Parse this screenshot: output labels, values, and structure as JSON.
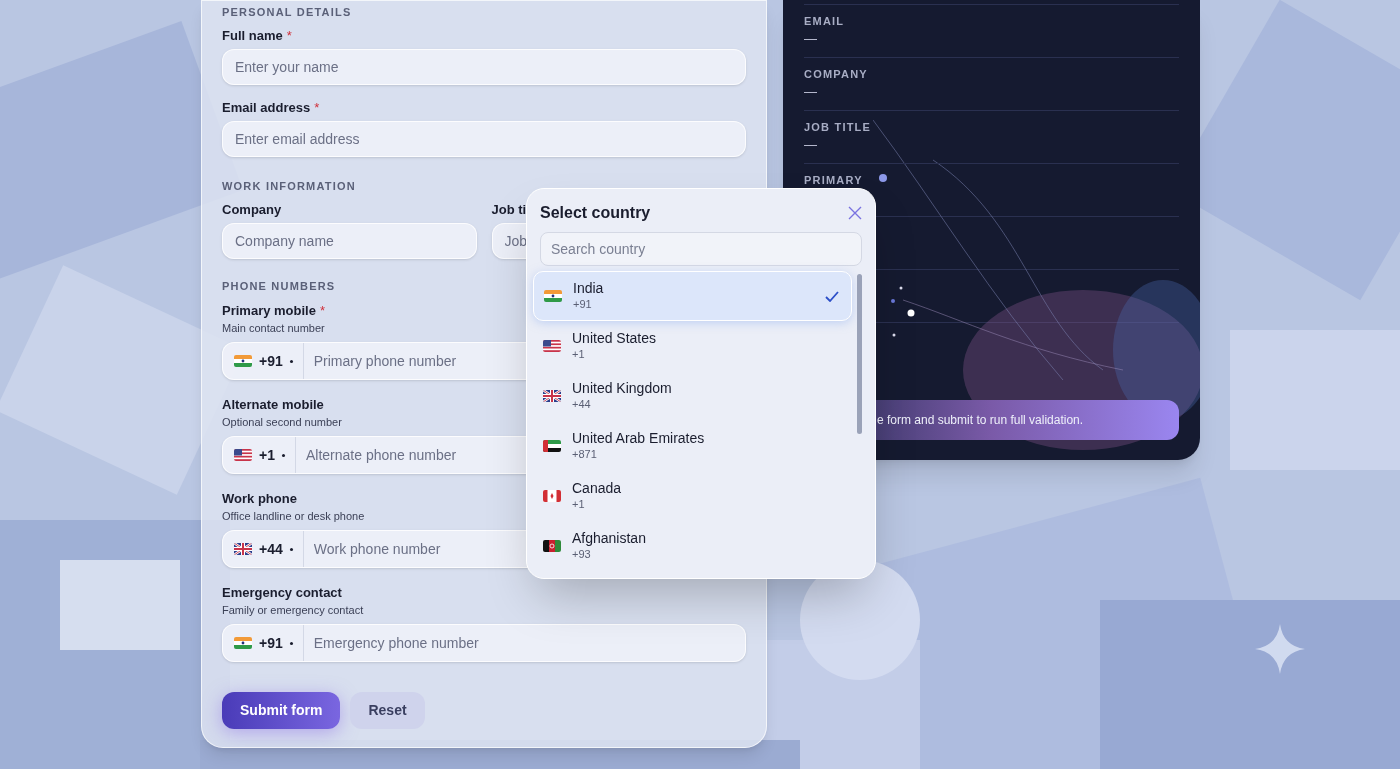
{
  "form": {
    "personal": {
      "heading": "PERSONAL DETAILS",
      "fields": [
        {
          "label": "Full name",
          "required_mark": "*",
          "placeholder": "Enter your name"
        },
        {
          "label": "Email address",
          "required_mark": "*",
          "placeholder": "Enter email address"
        }
      ]
    },
    "work": {
      "heading": "WORK INFORMATION",
      "fields": [
        {
          "label": "Company",
          "placeholder": "Company name"
        },
        {
          "label": "Job ti",
          "placeholder": "Job"
        }
      ]
    },
    "phones": {
      "heading": "PHONE NUMBERS",
      "fields": [
        {
          "label": "Primary mobile",
          "required_mark": "*",
          "hint": "Main contact number",
          "kind": "in",
          "dial": "+91",
          "placeholder": "Primary phone number"
        },
        {
          "label": "Alternate mobile",
          "hint": "Optional second number",
          "kind": "us",
          "dial": "+1",
          "placeholder": "Alternate phone number"
        },
        {
          "label": "Work phone",
          "hint": "Office landline or desk phone",
          "kind": "gb",
          "dial": "+44",
          "placeholder": "Work phone number"
        },
        {
          "label": "Emergency contact",
          "hint": "Family or emergency contact",
          "kind": "in",
          "dial": "+91",
          "placeholder": "Emergency phone number"
        }
      ]
    },
    "buttons": {
      "submit": "Submit form",
      "reset": "Reset"
    }
  },
  "summary": {
    "rows": [
      {
        "label": "EMAIL",
        "value": "—"
      },
      {
        "label": "COMPANY",
        "value": "—"
      },
      {
        "label": "JOB TITLE",
        "value": "—"
      },
      {
        "label": "PRIMARY"
      }
    ],
    "note": "e form and submit to run full validation."
  },
  "country_picker": {
    "title": "Select country",
    "search_placeholder": "Search country",
    "countries": [
      {
        "name": "India",
        "dial": "+91",
        "kind": "in",
        "selected": true
      },
      {
        "name": "United States",
        "dial": "+1",
        "kind": "us",
        "selected": false
      },
      {
        "name": "United Kingdom",
        "dial": "+44",
        "kind": "gb",
        "selected": false
      },
      {
        "name": "United Arab Emirates",
        "dial": "+871",
        "kind": "ae",
        "selected": false
      },
      {
        "name": "Canada",
        "dial": "+1",
        "kind": "ca",
        "selected": false
      },
      {
        "name": "Afghanistan",
        "dial": "+93",
        "kind": "af",
        "selected": false
      }
    ]
  }
}
